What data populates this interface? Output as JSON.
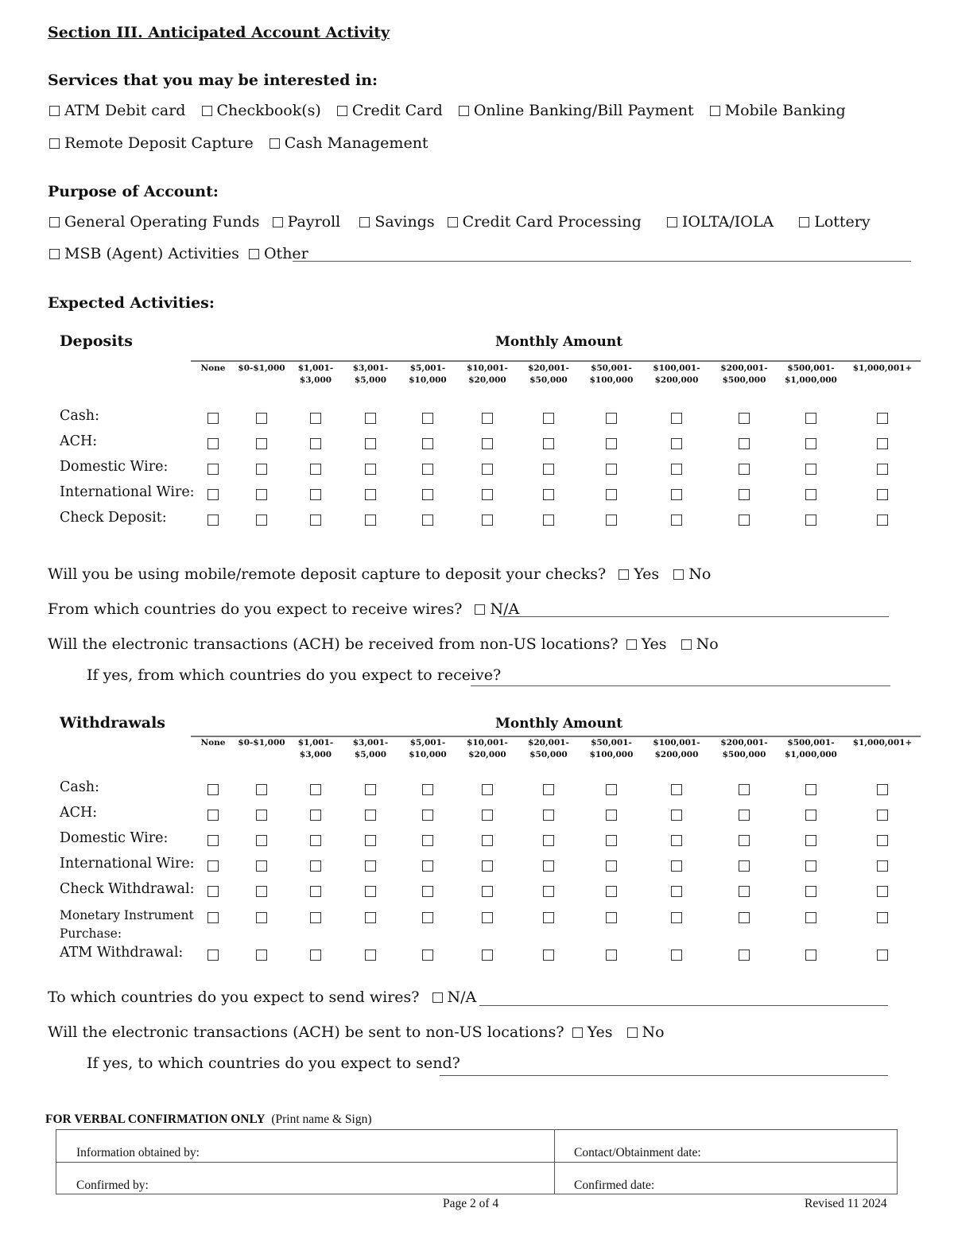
{
  "section_title": "Section III.  Anticipated Account Activity",
  "services": {
    "heading": "Services that you may be interested in:",
    "row1": [
      "ATM Debit card",
      "Checkbook(s)",
      "Credit Card",
      "Online Banking/Bill Payment",
      "Mobile Banking"
    ],
    "row2": [
      "Remote Deposit Capture",
      "Cash Management"
    ]
  },
  "purpose": {
    "heading": "Purpose of Account:",
    "row1": [
      "General Operating Funds",
      "Payroll",
      "Savings",
      "Credit Card Processing",
      "IOLTA/IOLA",
      "Lottery"
    ],
    "row2": [
      "MSB (Agent) Activities",
      "Other"
    ]
  },
  "expected_activities": {
    "heading": "Expected Activities:"
  },
  "amount_columns": [
    "None",
    "$0-$1,000",
    "$1,001-\n$3,000",
    "$3,001-\n$5,000",
    "$5,001-\n$10,000",
    "$10,001-\n$20,000",
    "$20,001-\n$50,000",
    "$50,001-\n$100,000",
    "$100,001-\n$200,000",
    "$200,001-\n$500,000",
    "$500,001-\n$1,000,000",
    "$1,000,001+"
  ],
  "deposits": {
    "title": "Deposits",
    "monthly_label": "Monthly Amount",
    "rows": [
      "Cash:",
      "ACH:",
      "Domestic Wire:",
      "International Wire:",
      "Check Deposit:"
    ]
  },
  "deposit_questions": {
    "q1": "Will you be using mobile/remote deposit capture to deposit your checks?",
    "q1_yes": "Yes",
    "q1_no": "No",
    "q2": "From which countries do you expect to receive wires?",
    "q2_na": "N/A",
    "q3": "Will the electronic transactions (ACH) be received from non-US locations?",
    "q3_yes": "Yes",
    "q3_no": "No",
    "q4": "If yes, from which countries do you expect to receive?"
  },
  "withdrawals": {
    "title": "Withdrawals",
    "monthly_label": "Monthly Amount",
    "rows": [
      "Cash:",
      "ACH:",
      "Domestic Wire:",
      "International Wire:",
      "Check Withdrawal:",
      "Monetary Instrument\nPurchase:",
      "ATM Withdrawal:"
    ]
  },
  "withdrawal_questions": {
    "q1": "To which countries do you expect to send wires?",
    "q1_na": "N/A",
    "q2": "Will the electronic transactions (ACH) be sent to non-US locations?",
    "q2_yes": "Yes",
    "q2_no": "No",
    "q3": "If yes, to which countries do you expect to send?"
  },
  "verbal": {
    "title_bold": "FOR VERBAL CONFIRMATION ONLY",
    "title_rest": "(Print name & Sign)",
    "obtained_by": "Information obtained by:",
    "contact_date": "Contact/Obtainment date:",
    "confirmed_by": "Confirmed by:",
    "confirmed_date": "Confirmed date:"
  },
  "footer": {
    "page": "Page 2 of 4",
    "revised": "Revised 11 2024"
  }
}
